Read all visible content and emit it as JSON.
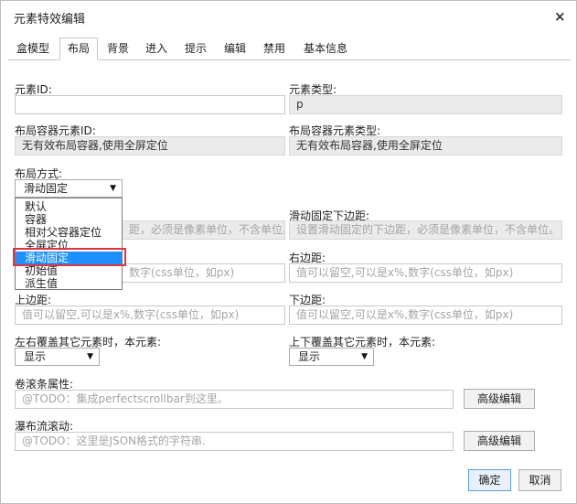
{
  "dialog": {
    "title": "元素特效编辑",
    "close_label": "×"
  },
  "tabs": [
    {
      "label": "盒模型"
    },
    {
      "label": "布局",
      "active": true
    },
    {
      "label": "背景"
    },
    {
      "label": "进入"
    },
    {
      "label": "提示"
    },
    {
      "label": "编辑"
    },
    {
      "label": "禁用"
    },
    {
      "label": "基本信息"
    }
  ],
  "fields": {
    "element_id": {
      "label": "元素ID:",
      "value": ""
    },
    "element_type": {
      "label": "元素类型:",
      "value": "p"
    },
    "container_id": {
      "label": "布局容器元素ID:",
      "value": "无有效布局容器,使用全屏定位"
    },
    "container_type": {
      "label": "布局容器元素类型:",
      "value": "无有效布局容器,使用全屏定位"
    },
    "layout_mode": {
      "label": "布局方式:",
      "value": "滑动固定",
      "arrow": "▼"
    },
    "scroll_bottom": {
      "label": "滑动固定下边距:",
      "placeholder": "设置滑动固定的下边距，必须是像素单位，不含单位。"
    },
    "scroll_top_hidden": {
      "placeholder": "距，必须是像素单位，不含单位。"
    },
    "left": {
      "placeholder": "数字(css单位，如px)"
    },
    "right": {
      "label": "右边距:",
      "placeholder": "值可以留空,可以是x%,数字(css单位，如px)"
    },
    "top": {
      "label": "上边距:",
      "placeholder": "值可以留空,可以是x%,数字(css单位，如px)"
    },
    "bottom": {
      "label": "下边距:",
      "placeholder": "值可以留空,可以是x%,数字(css单位，如px)"
    },
    "overlap_h": {
      "label": "左右覆盖其它元素时，本元素:",
      "value": "显示",
      "arrow": "▼"
    },
    "overlap_v": {
      "label": "上下覆盖其它元素时，本元素:",
      "value": "显示",
      "arrow": "▼"
    },
    "scrollbar": {
      "label": "卷滚条属性:",
      "placeholder": "@TODO：集成perfectscrollbar到这里。",
      "button": "高级编辑"
    },
    "waterfall": {
      "label": "瀑布流滚动:",
      "placeholder": "@TODO：这里是JSON格式的字符串.",
      "button": "高级编辑"
    }
  },
  "dropdown": {
    "options": [
      "默认",
      "容器",
      "相对父容器定位",
      "全屏定位",
      "滑动固定",
      "初始值",
      "派生值"
    ],
    "selected_index": 4
  },
  "footer": {
    "ok": "确定",
    "cancel": "取消"
  }
}
